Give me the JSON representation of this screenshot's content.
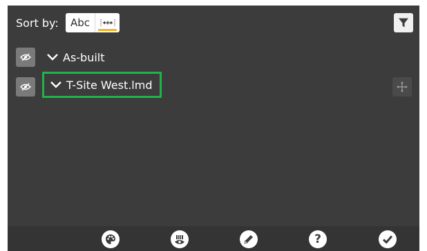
{
  "sort": {
    "label": "Sort by:",
    "options": [
      {
        "label": "Abc",
        "selected": false
      },
      {
        "icon": "distance-sort-icon",
        "selected": true
      }
    ],
    "accent_color": "#f2b21b"
  },
  "layers": [
    {
      "label": "As-built",
      "expanded": true,
      "visibility_icon": "eye-slash-icon"
    },
    {
      "label": "T-Site West.lmd",
      "expanded": true,
      "visibility_icon": "eye-slash-icon",
      "highlighted": true
    }
  ],
  "highlight_color": "#22b14c",
  "toolbar": {
    "buttons": [
      {
        "icon": "palette-icon"
      },
      {
        "icon": "visibility-settings-icon"
      },
      {
        "icon": "pencil-icon"
      },
      {
        "icon": "help-icon",
        "label": "?"
      },
      {
        "icon": "checkmark-icon"
      }
    ]
  }
}
